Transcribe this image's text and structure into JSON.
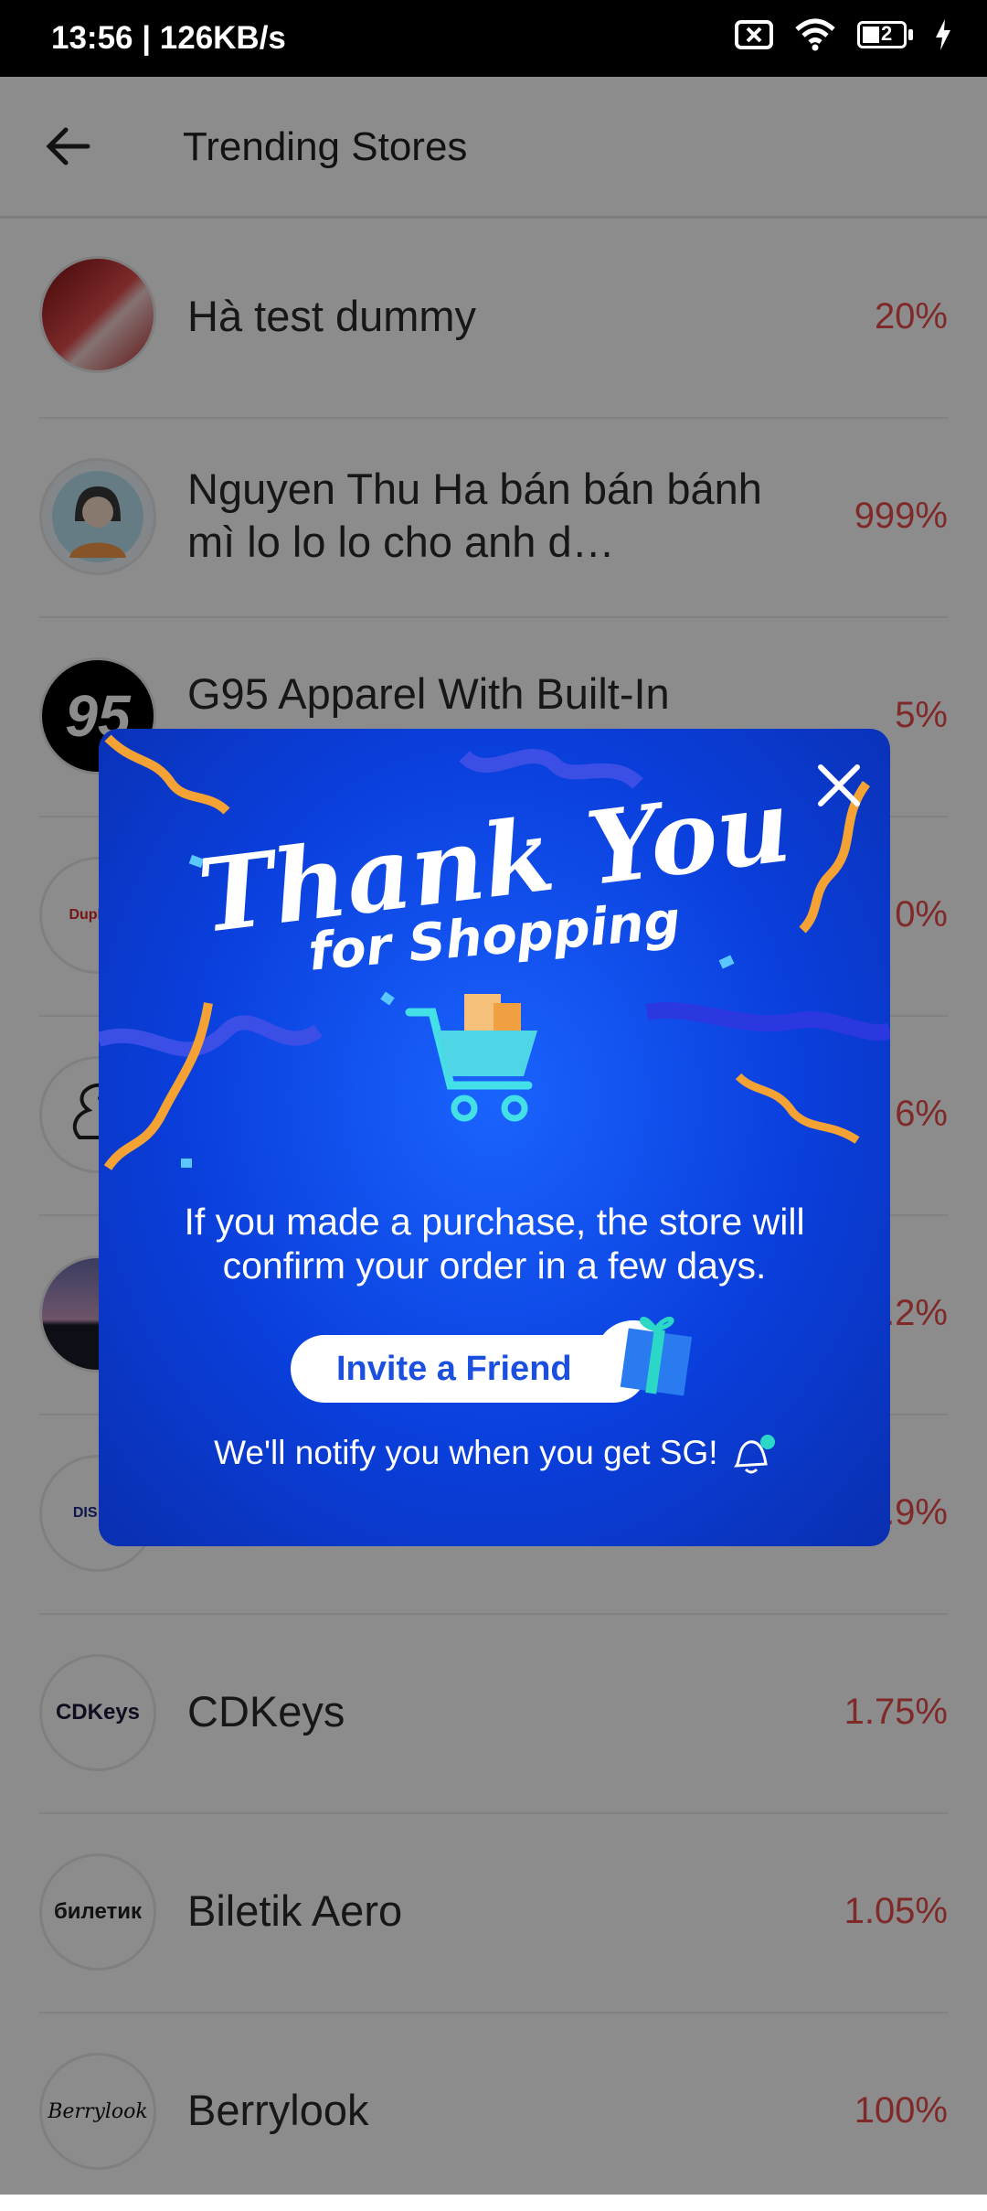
{
  "status_bar": {
    "time": "13:56 | 126KB/s",
    "battery": "2"
  },
  "app_bar": {
    "title": "Trending Stores",
    "back_icon": "arrow-left-icon"
  },
  "stores": [
    {
      "name": "Hà test dummy",
      "percent": "20%"
    },
    {
      "name": "Nguyen Thu Ha bán bán bánh mì lo lo lo cho anh d…",
      "percent": "999%"
    },
    {
      "name": "G95 Apparel With Built-In",
      "percent": "5%"
    },
    {
      "name": "",
      "percent": "0%",
      "logo_text": "Duplicat"
    },
    {
      "name": "",
      "percent": "6%"
    },
    {
      "name": "",
      "percent": ".2%"
    },
    {
      "name": "",
      "percent": ".9%",
      "logo_text": "DIS CA"
    },
    {
      "name": "CDKeys",
      "percent": "1.75%",
      "logo_text": "CDKeys"
    },
    {
      "name": "Biletik Aero",
      "percent": "1.05%",
      "logo_text": "билетик"
    },
    {
      "name": "Berrylook",
      "percent": "100%",
      "logo_text": "Berrylook"
    }
  ],
  "popup": {
    "title_line1": "Thank You",
    "title_line2": "for Shopping",
    "message": "If you made a purchase, the store will confirm your order in a few days.",
    "invite_button": "Invite a Friend",
    "notify_text": "We'll notify you when you get SG!",
    "close_icon": "close-icon",
    "colors": {
      "accent": "#1a4fe0",
      "percent": "#e94b4b"
    }
  }
}
